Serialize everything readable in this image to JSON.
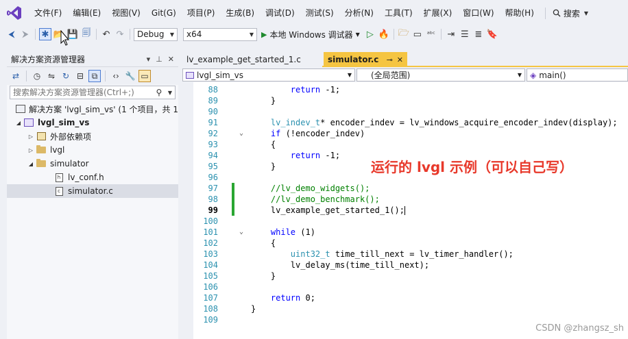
{
  "menubar": {
    "items": [
      "文件(F)",
      "编辑(E)",
      "视图(V)",
      "Git(G)",
      "项目(P)",
      "生成(B)",
      "调试(D)",
      "测试(S)",
      "分析(N)",
      "工具(T)",
      "扩展(X)",
      "窗口(W)",
      "帮助(H)"
    ],
    "search_label": "搜索",
    "search_icon": "search-icon"
  },
  "toolbar": {
    "config": "Debug",
    "platform": "x64",
    "run_label": "本地 Windows 调试器"
  },
  "solution_explorer": {
    "title": "解决方案资源管理器",
    "search_placeholder": "搜索解决方案资源管理器(Ctrl+;)",
    "tree": [
      {
        "label": "解决方案 'lvgl_sim_vs' (1 个项目，共 1",
        "kind": "solution"
      },
      {
        "label": "lvgl_sim_vs",
        "kind": "project"
      },
      {
        "label": "外部依赖项",
        "kind": "deps"
      },
      {
        "label": "lvgl",
        "kind": "folder"
      },
      {
        "label": "simulator",
        "kind": "folder"
      },
      {
        "label": "lv_conf.h",
        "kind": "header"
      },
      {
        "label": "simulator.c",
        "kind": "source"
      }
    ]
  },
  "editor": {
    "tabs": [
      {
        "label": "lv_example_get_started_1.c",
        "active": false
      },
      {
        "label": "simulator.c",
        "active": true
      }
    ],
    "nav": {
      "project": "lvgl_sim_vs",
      "scope": "(全局范围)",
      "member": "main()"
    },
    "current_line": "99",
    "lines": [
      {
        "n": "88",
        "code": "        return -1;"
      },
      {
        "n": "89",
        "code": "    }"
      },
      {
        "n": "90",
        "code": ""
      },
      {
        "n": "91",
        "code": "    lv_indev_t* encoder_indev = lv_windows_acquire_encoder_indev(display);"
      },
      {
        "n": "92",
        "code": "    if (!encoder_indev)"
      },
      {
        "n": "93",
        "code": "    {"
      },
      {
        "n": "94",
        "code": "        return -1;"
      },
      {
        "n": "95",
        "code": "    }"
      },
      {
        "n": "96",
        "code": ""
      },
      {
        "n": "97",
        "code": "    //lv_demo_widgets();"
      },
      {
        "n": "98",
        "code": "    //lv_demo_benchmark();"
      },
      {
        "n": "99",
        "code": "    lv_example_get_started_1();"
      },
      {
        "n": "100",
        "code": ""
      },
      {
        "n": "101",
        "code": "    while (1)"
      },
      {
        "n": "102",
        "code": "    {"
      },
      {
        "n": "103",
        "code": "        uint32_t time_till_next = lv_timer_handler();"
      },
      {
        "n": "104",
        "code": "        lv_delay_ms(time_till_next);"
      },
      {
        "n": "105",
        "code": "    }"
      },
      {
        "n": "106",
        "code": ""
      },
      {
        "n": "107",
        "code": "    return 0;"
      },
      {
        "n": "108",
        "code": "}"
      },
      {
        "n": "109",
        "code": ""
      }
    ]
  },
  "annotation": "运行的 lvgl 示例（可以自己写）",
  "watermark": "CSDN @zhangsz_sh",
  "colors": {
    "accent": "#f5c542",
    "keyword": "#0000ff",
    "type": "#2b91af",
    "comment": "#008000",
    "annotation": "#e8392b"
  }
}
